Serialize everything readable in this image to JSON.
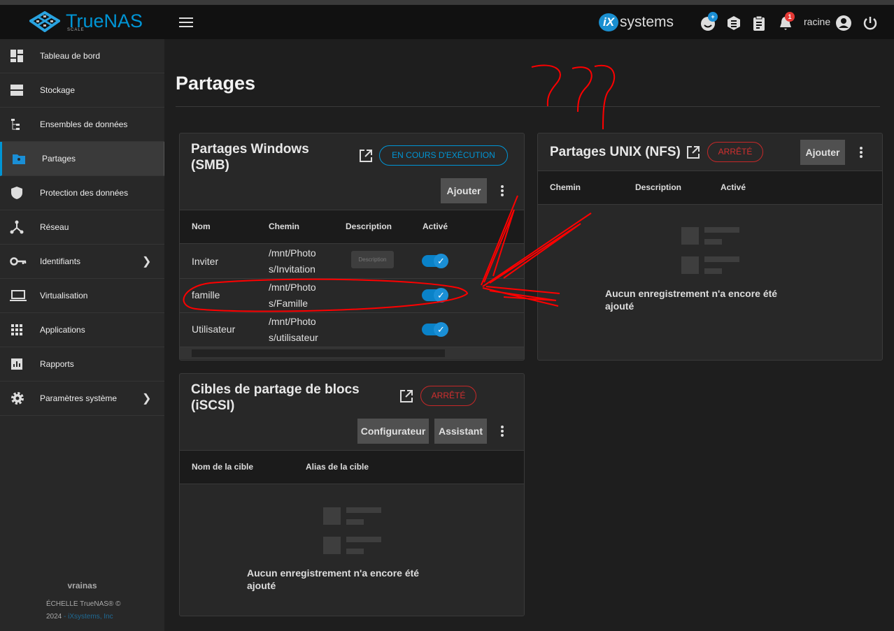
{
  "header": {
    "brand": "TrueNAS",
    "brand_sub": "SCALE",
    "vendor": "systems",
    "user": "racine",
    "notifications": "1",
    "colors": {
      "accent": "#0095d5",
      "badge": "#e53935"
    }
  },
  "sidebar": {
    "items": [
      {
        "label": "Tableau de bord",
        "icon": "dashboard-icon"
      },
      {
        "label": "Stockage",
        "icon": "storage-icon"
      },
      {
        "label": "Ensembles de données",
        "icon": "datasets-icon"
      },
      {
        "label": "Partages",
        "icon": "shares-icon",
        "active": true
      },
      {
        "label": "Protection des données",
        "icon": "shield-icon"
      },
      {
        "label": "Réseau",
        "icon": "network-icon"
      },
      {
        "label": "Identifiants",
        "icon": "key-icon",
        "expandable": true
      },
      {
        "label": "Virtualisation",
        "icon": "laptop-icon"
      },
      {
        "label": "Applications",
        "icon": "apps-icon"
      },
      {
        "label": "Rapports",
        "icon": "reports-icon"
      },
      {
        "label": "Paramètres système",
        "icon": "gear-icon",
        "expandable": true
      }
    ],
    "hostname": "vrainas",
    "copyright": "ÉCHELLE TrueNAS® ©",
    "year": "2024",
    "company": "- iXsystems, Inc"
  },
  "page": {
    "title": "Partages"
  },
  "smb": {
    "title_line1": "Partages Windows",
    "title_line2": "(SMB)",
    "status": "EN COURS D'EXÉCUTION",
    "add": "Ajouter",
    "columns": [
      "Nom",
      "Chemin",
      "Description",
      "Activé"
    ],
    "rows": [
      {
        "name": "Inviter",
        "path1": "/mnt/Photo",
        "path2": "s/Invitation",
        "description": "Description",
        "enabled": true
      },
      {
        "name": "famille",
        "path1": "/mnt/Photo",
        "path2": "s/Famille",
        "description": "",
        "enabled": true
      },
      {
        "name": "Utilisateur",
        "path1": "/mnt/Photo",
        "path2": "s/utilisateur",
        "description": "",
        "enabled": true
      }
    ]
  },
  "nfs": {
    "title": "Partages UNIX (NFS)",
    "status": "ARRÊTÉ",
    "add": "Ajouter",
    "columns": [
      "Chemin",
      "Description",
      "Activé"
    ],
    "empty_line1": "Aucun enregistrement n'a encore été",
    "empty_line2": "ajouté"
  },
  "iscsi": {
    "title_line1": "Cibles de partage de blocs",
    "title_line2": "(iSCSI)",
    "status": "ARRÊTÉ",
    "configure": "Configurateur",
    "wizard": "Assistant",
    "columns": [
      "Nom de la cible",
      "Alias de la cible"
    ],
    "empty_line1": "Aucun enregistrement n'a encore été",
    "empty_line2": "ajouté"
  }
}
